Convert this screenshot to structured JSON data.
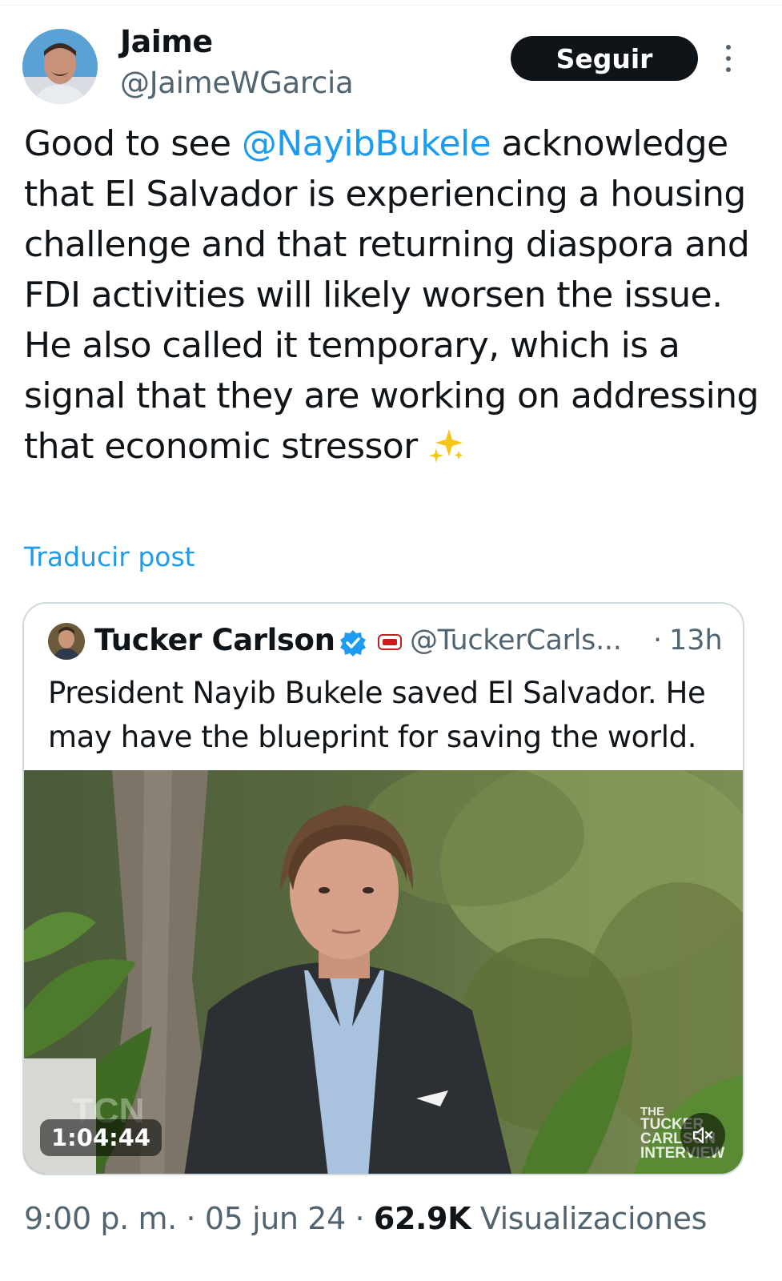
{
  "author": {
    "name": "Jaime",
    "handle": "@JaimeWGarcia",
    "follow_label": "Seguir",
    "avatar_icon": "user-avatar",
    "more_icon": "more-vertical-icon"
  },
  "tweet": {
    "text_prefix": "Good to see ",
    "mention": "@NayibBukele",
    "text_body": "acknowledge that El Salvador is experiencing a housing challenge and that returning diaspora and FDI activities will likely worsen the issue. He also called it temporary, which is a signal that they are working on addressing that economic stressor",
    "emoji_icon": "sparkles-icon",
    "translate_label": "Traducir post"
  },
  "quote": {
    "name": "Tucker Carlson",
    "verified_icon": "verified-badge-icon",
    "affiliate_icon": "tcn-badge-icon",
    "handle": "@TuckerCarls...",
    "separator": "·",
    "time": "13h",
    "text": "President Nayib Bukele saved El Salvador. He may have the blueprint for saving the world.",
    "video": {
      "duration": "1:04:44",
      "mute_icon": "volume-muted-icon",
      "watermark": [
        "THE",
        "TUCKER",
        "CARLSON",
        "INTERVIEW"
      ],
      "overlay_logo": "TCN"
    }
  },
  "meta": {
    "time": "9:00 p. m.",
    "sep1": "·",
    "date": "05 jun 24",
    "sep2": "·",
    "views_count": "62.9K",
    "views_label": "Visualizaciones"
  },
  "colors": {
    "link": "#1d9bf0",
    "text_primary": "#0f1419",
    "text_secondary": "#536471",
    "border": "#cfd9de",
    "button_bg": "#0f1419"
  }
}
